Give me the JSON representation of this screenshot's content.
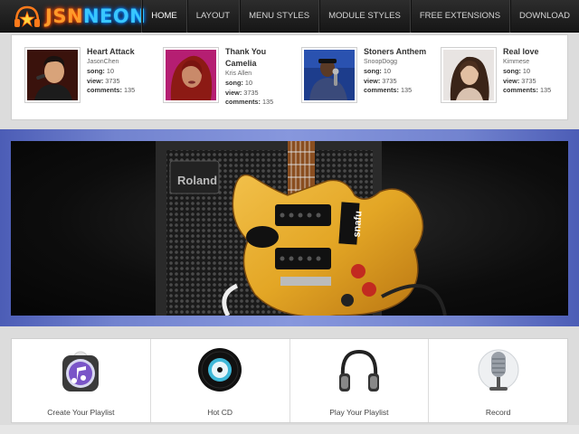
{
  "header": {
    "logo": {
      "part1": "JSN",
      "part2": "NEON"
    },
    "nav": [
      {
        "label": "HOME",
        "active": true
      },
      {
        "label": "LAYOUT"
      },
      {
        "label": "MENU STYLES"
      },
      {
        "label": "MODULE STYLES"
      },
      {
        "label": "FREE EXTENSIONS"
      },
      {
        "label": "DOWNLOAD"
      }
    ]
  },
  "artists": [
    {
      "title": "Heart Attack",
      "artist": "JasonChen",
      "song_label": "song:",
      "song": "10",
      "view_label": "view:",
      "view": "3735",
      "comments_label": "comments:",
      "comments": "135"
    },
    {
      "title": "Thank You Camelia",
      "artist": "Kris Allen",
      "song_label": "song:",
      "song": "10",
      "view_label": "view:",
      "view": "3735",
      "comments_label": "comments:",
      "comments": "135"
    },
    {
      "title": "Stoners Anthem",
      "artist": "SnoopDogg",
      "song_label": "song:",
      "song": "10",
      "view_label": "view:",
      "view": "3735",
      "comments_label": "comments:",
      "comments": "135"
    },
    {
      "title": "Real love",
      "artist": "Kimmese",
      "song_label": "song:",
      "song": "10",
      "view_label": "view:",
      "view": "3735",
      "comments_label": "comments:",
      "comments": "135"
    }
  ],
  "banner": {
    "amp_brand": "Roland",
    "sticker_brand": "snafu"
  },
  "features": [
    {
      "label": "Create Your Playlist",
      "icon": "music-note-icon"
    },
    {
      "label": "Hot CD",
      "icon": "cd-icon"
    },
    {
      "label": "Play Your Playlist",
      "icon": "headphones-icon"
    },
    {
      "label": "Record",
      "icon": "microphone-icon"
    }
  ],
  "colors": {
    "header_bg": "#1e1e1e",
    "logo_orange": "#ff9a2a",
    "logo_blue": "#39c6ff",
    "banner_blue": "#7283cf",
    "guitar_yellow": "#e3a625"
  }
}
